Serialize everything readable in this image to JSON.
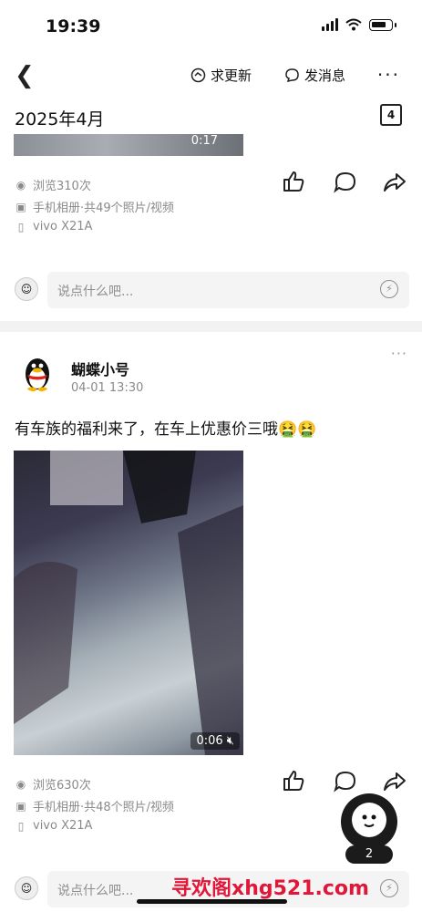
{
  "status_bar": {
    "time": "19:39"
  },
  "header": {
    "request_update": "求更新",
    "send_message": "发消息",
    "more": "···"
  },
  "month_label": "2025年4月",
  "calendar_day": "4",
  "post1": {
    "duration": "0:17",
    "views": "浏览310次",
    "album": "手机相册·共49个照片/视频",
    "device": "vivo X21A",
    "comment_placeholder": "说点什么吧..."
  },
  "post2": {
    "author": "蝴蝶小号",
    "time": "04-01 13:30",
    "caption": "有车族的福利来了，在车上优惠价三哦🤮🤮",
    "duration": "0:06",
    "views": "浏览630次",
    "album": "手机相册·共48个照片/视频",
    "device": "vivo X21A",
    "comment_placeholder": "说点什么吧..."
  },
  "floating_badge": "2",
  "watermark": "寻欢阁xhg521.com"
}
